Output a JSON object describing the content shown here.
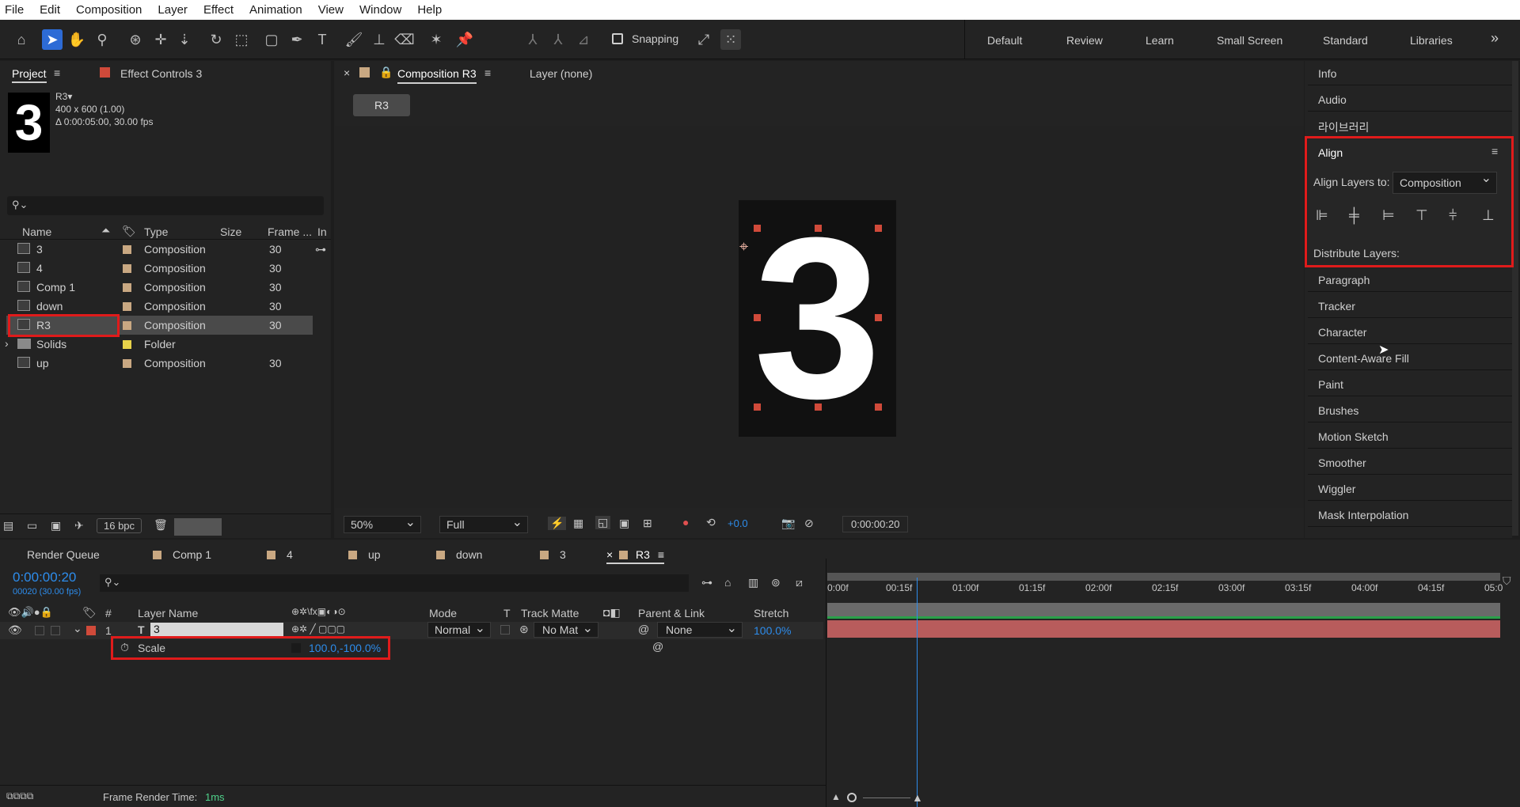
{
  "menu": [
    "File",
    "Edit",
    "Composition",
    "Layer",
    "Effect",
    "Animation",
    "View",
    "Window",
    "Help"
  ],
  "toolbar": {
    "snapping_label": "Snapping",
    "workspaces": [
      "Default",
      "Review",
      "Learn",
      "Small Screen",
      "Standard",
      "Libraries"
    ],
    "overflow": "»"
  },
  "project": {
    "tab_label": "Project",
    "effect_controls_tab": "Effect Controls 3",
    "thumb_digit": "3",
    "item_name": "R3▾",
    "item_size": "400 x 600 (1.00)",
    "item_duration": "Δ 0:00:05:00, 30.00 fps",
    "search_placeholder": "",
    "columns": {
      "name": "Name",
      "type": "Type",
      "size": "Size",
      "frame": "Frame ...",
      "in": "In"
    },
    "items": [
      {
        "name": "3",
        "type": "Composition",
        "frame": "30"
      },
      {
        "name": "4",
        "type": "Composition",
        "frame": "30"
      },
      {
        "name": "Comp 1",
        "type": "Composition",
        "frame": "30"
      },
      {
        "name": "down",
        "type": "Composition",
        "frame": "30"
      },
      {
        "name": "R3",
        "type": "Composition",
        "frame": "30"
      },
      {
        "name": "Solids",
        "type": "Folder",
        "frame": ""
      },
      {
        "name": "up",
        "type": "Composition",
        "frame": "30"
      }
    ],
    "bpc": "16 bpc"
  },
  "viewer": {
    "tab_label": "Composition R3",
    "layer_tab": "Layer (none)",
    "breadcrumb": "R3",
    "big_digit": "3",
    "zoom": "50%",
    "resolution": "Full",
    "exposure": "+0.0",
    "timecode": "0:00:00:20"
  },
  "right_panels": {
    "top": [
      "Info",
      "Audio",
      "라이브러리"
    ],
    "align_title": "Align",
    "align_layers_to_label": "Align Layers to:",
    "align_layers_to_value": "Composition",
    "distribute_label": "Distribute Layers:",
    "bottom": [
      "Paragraph",
      "Tracker",
      "Character",
      "Content-Aware Fill",
      "Paint",
      "Brushes",
      "Motion Sketch",
      "Smoother",
      "Wiggler",
      "Mask Interpolation"
    ]
  },
  "timeline": {
    "render_queue": "Render Queue",
    "tabs": [
      "Comp 1",
      "4",
      "up",
      "down",
      "3",
      "R3"
    ],
    "timecode": "0:00:00:20",
    "timecode_sub": "00020 (30.00 fps)",
    "columns": {
      "num": "#",
      "layer_name": "Layer Name",
      "mode": "Mode",
      "t": "T",
      "track_matte": "Track Matte",
      "parent": "Parent & Link",
      "stretch": "Stretch"
    },
    "layer": {
      "index": "1",
      "name": "3",
      "mode": "Normal",
      "matte": "No Mat",
      "parent": "None",
      "stretch": "100.0%"
    },
    "property": {
      "name": "Scale",
      "value": "100.0,-100.0%"
    },
    "ruler_labels": [
      "0:00f",
      "00:15f",
      "01:00f",
      "01:15f",
      "02:00f",
      "02:15f",
      "03:00f",
      "03:15f",
      "04:00f",
      "04:15f",
      "05:0"
    ],
    "playhead_fraction": 0.133,
    "frame_render_label": "Frame Render Time:",
    "frame_render_value": "1ms"
  },
  "colors": {
    "accent": "#2d8ceb",
    "highlight": "#e01b1b",
    "layer_bar": "#b85c5c",
    "comp_label": "#c9a882",
    "folder_label": "#e8d24a"
  }
}
